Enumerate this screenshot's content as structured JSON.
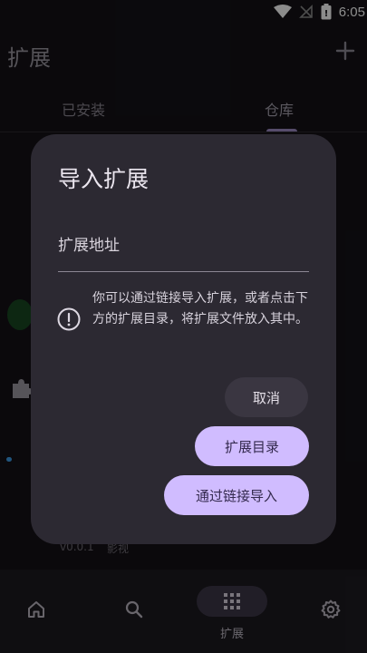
{
  "status": {
    "time": "6:05"
  },
  "app_bar": {
    "title": "扩展"
  },
  "tabs": [
    {
      "label": "已安装"
    },
    {
      "label": "仓库",
      "selected": true
    }
  ],
  "background_list": {
    "version": "v0.0.1",
    "category": "影视",
    "side_text": "表"
  },
  "bottom_nav": {
    "selected_label": "扩展",
    "items": [
      {
        "icon": "home-icon"
      },
      {
        "icon": "search-icon"
      },
      {
        "icon": "apps-grid-icon",
        "label": "扩展"
      },
      {
        "icon": "gear-icon"
      }
    ]
  },
  "dialog": {
    "title": "导入扩展",
    "url_label": "扩展地址",
    "url_value": "",
    "info_text": "你可以通过链接导入扩展，或者点击下方的扩展目录，将扩展文件放入其中。",
    "cancel_label": "取消",
    "catalog_label": "扩展目录",
    "import_label": "通过链接导入"
  },
  "colors": {
    "accent": "#d0bcff",
    "dialog_bg": "#2c2932",
    "screen_bg": "#141217"
  }
}
